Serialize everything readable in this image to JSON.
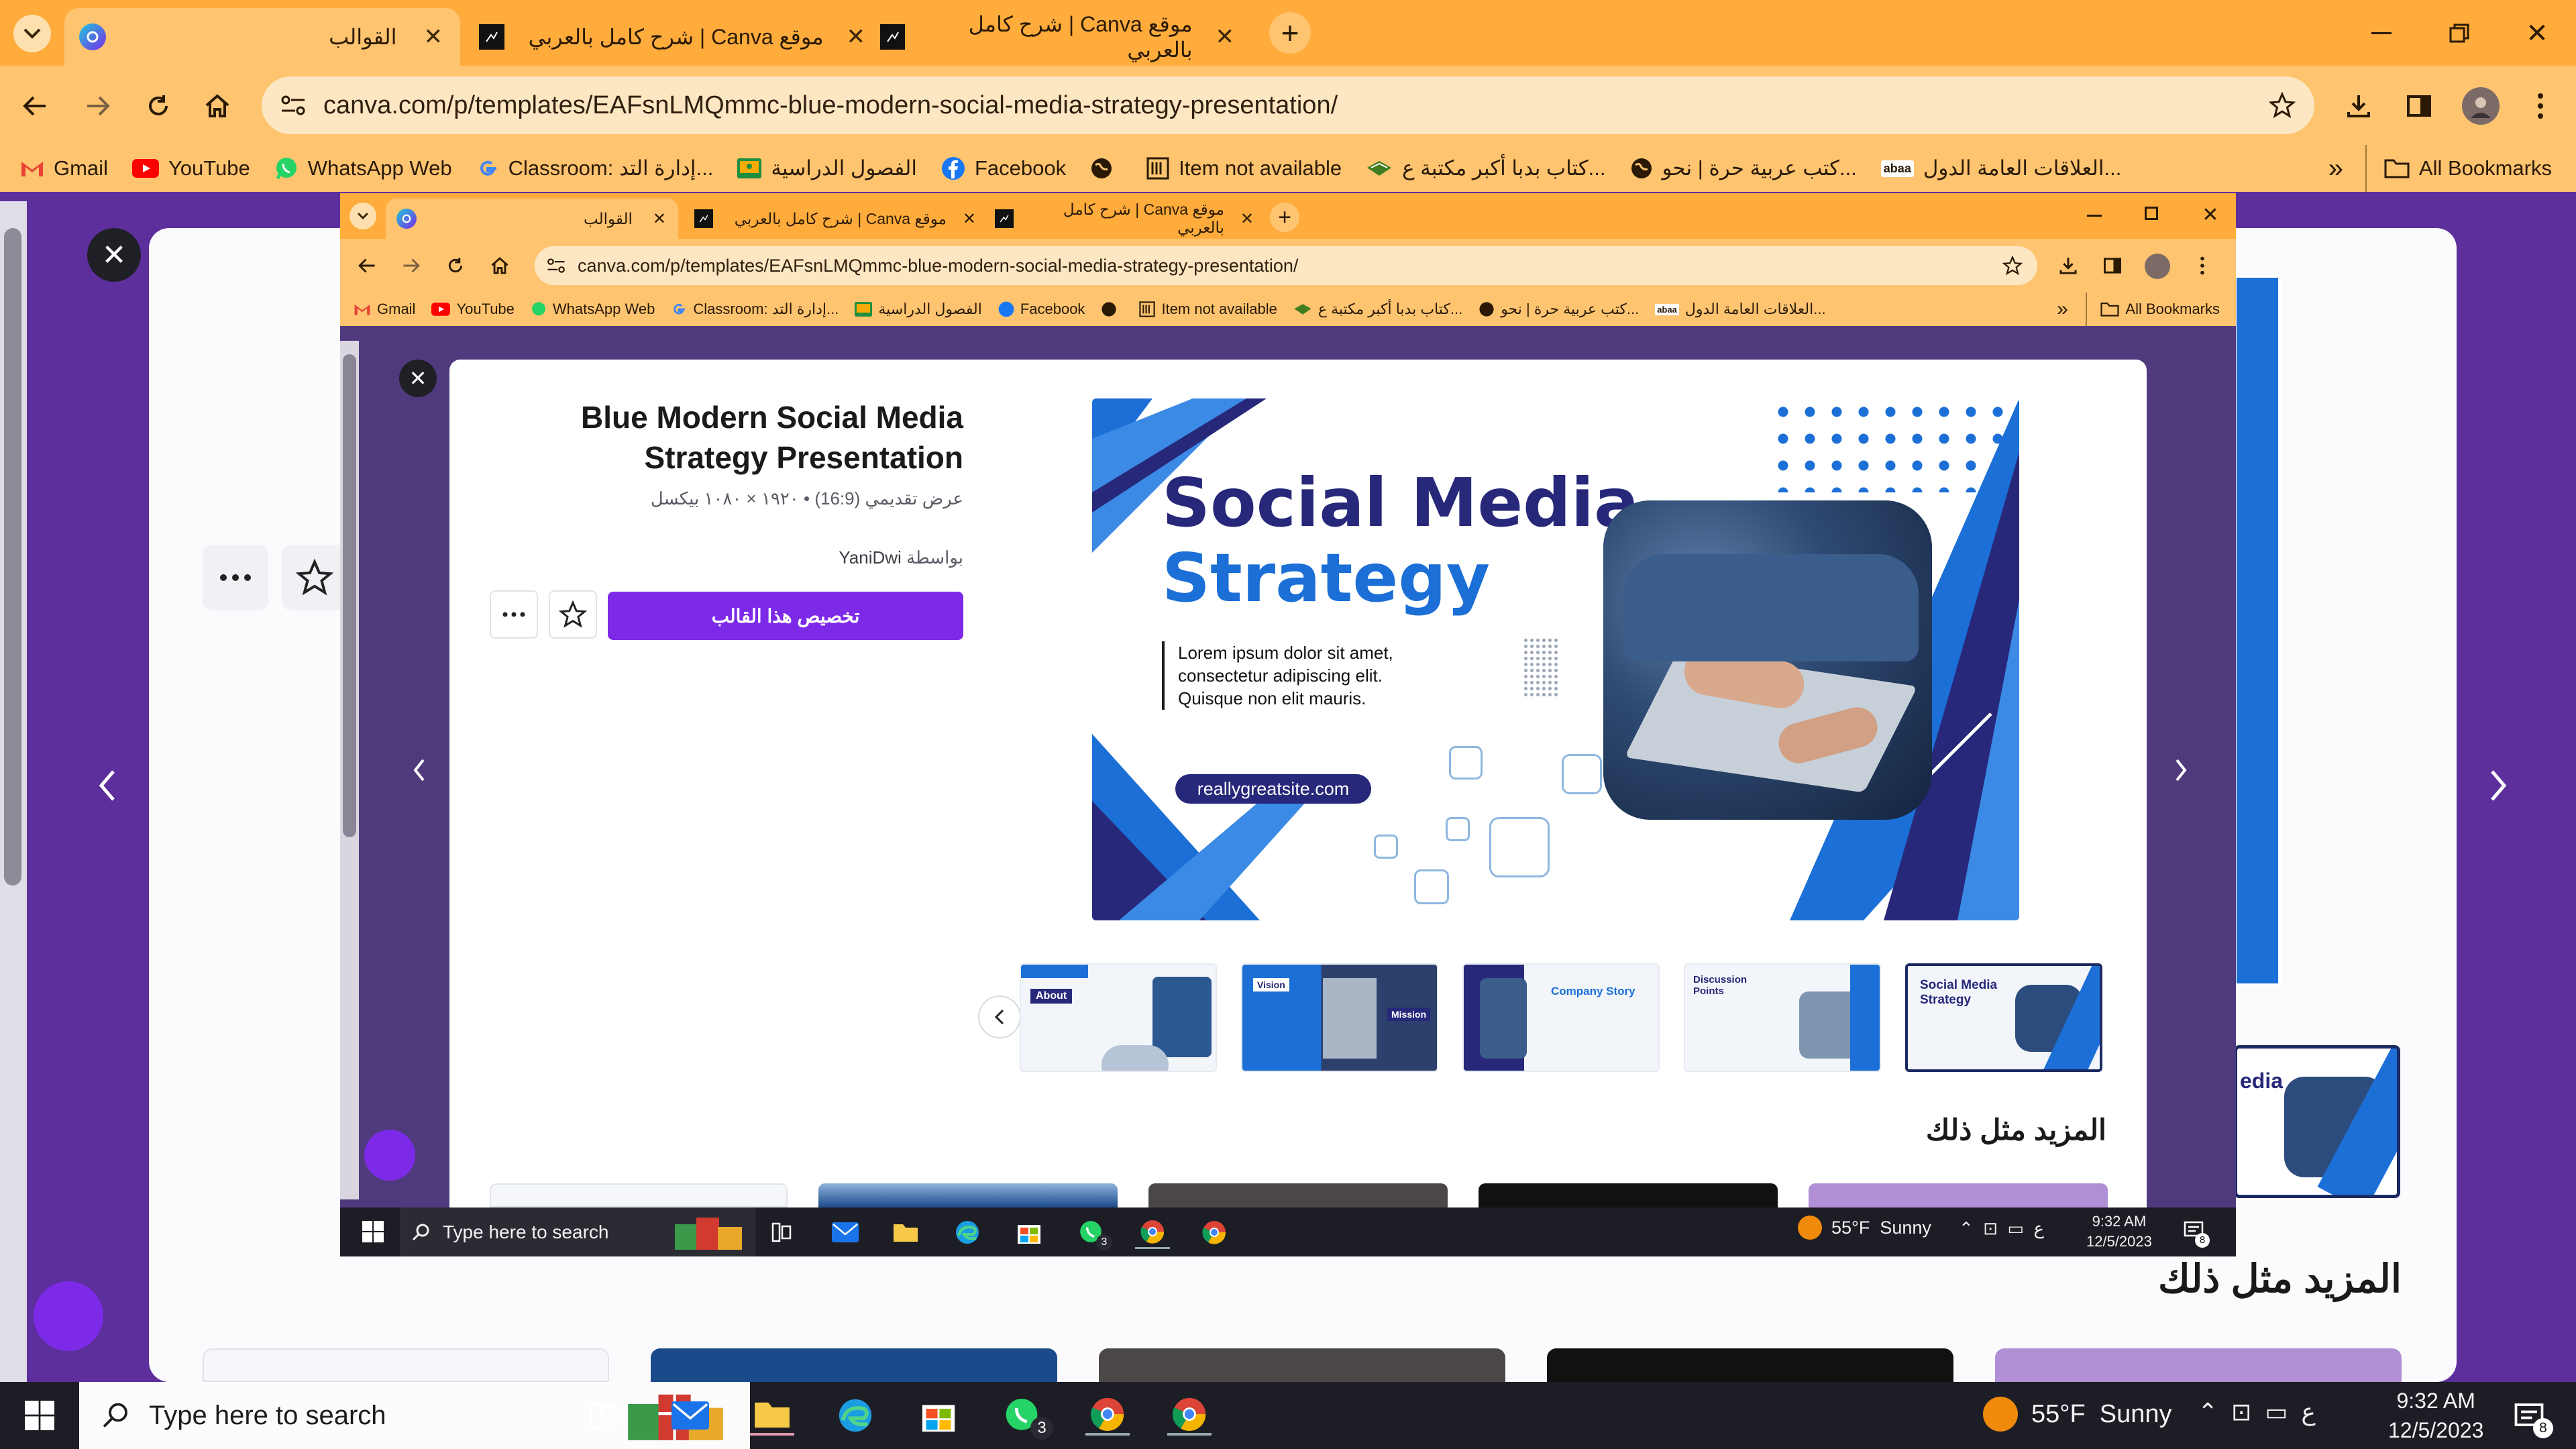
{
  "outer": {
    "tabs": [
      {
        "title": "القوالب",
        "icon": "canva-icon",
        "active": true
      },
      {
        "title": "موقع Canva | شرح كامل بالعربي",
        "icon": "site-favicon",
        "active": false
      },
      {
        "title": "موقع Canva | شرح كامل بالعربي",
        "icon": "site-favicon",
        "active": false
      }
    ],
    "url": "canva.com/p/templates/EAFsnLMQmmc-blue-modern-social-media-strategy-presentation/",
    "bookmarks": [
      {
        "label": "Gmail",
        "icon": "gmail-icon"
      },
      {
        "label": "YouTube",
        "icon": "youtube-icon"
      },
      {
        "label": "WhatsApp Web",
        "icon": "whatsapp-icon"
      },
      {
        "label": "Classroom: إدارة التد...",
        "icon": "google-icon"
      },
      {
        "label": "الفصول الدراسية",
        "icon": "classroom-icon"
      },
      {
        "label": "Facebook",
        "icon": "facebook-icon"
      },
      {
        "label": "",
        "icon": "globe-icon"
      },
      {
        "label": "Item not available",
        "icon": "book-icon"
      },
      {
        "label": "كتاب بدبا أكبر مكتبة ع...",
        "icon": "library-icon"
      },
      {
        "label": "كتب عربية حرة | نحو...",
        "icon": "globe-icon"
      },
      {
        "label": "العلاقات العامة الدول...",
        "icon": "abaa-icon"
      }
    ],
    "all_bookmarks": "All Bookmarks",
    "more_like_this": "المزيد مثل ذلك",
    "partial_slide_text": "edia"
  },
  "inner": {
    "tabs": [
      {
        "title": "القوالب",
        "active": true
      },
      {
        "title": "موقع Canva | شرح كامل بالعربي",
        "active": false
      },
      {
        "title": "موقع Canva | شرح كامل بالعربي",
        "active": false
      }
    ],
    "url": "canva.com/p/templates/EAFsnLMQmmc-blue-modern-social-media-strategy-presentation/",
    "bookmarks": [
      {
        "label": "Gmail"
      },
      {
        "label": "YouTube"
      },
      {
        "label": "WhatsApp Web"
      },
      {
        "label": "Classroom: إدارة التد..."
      },
      {
        "label": "الفصول الدراسية"
      },
      {
        "label": "Facebook"
      },
      {
        "label": ""
      },
      {
        "label": "Item not available"
      },
      {
        "label": "كتاب بدبا أكبر مكتبة ع..."
      },
      {
        "label": "كتب عربية حرة | نحو..."
      },
      {
        "label": "العلاقات العامة الدول..."
      }
    ],
    "all_bookmarks": "All Bookmarks"
  },
  "template": {
    "title_line1": "Blue Modern Social Media",
    "title_line2": "Strategy Presentation",
    "meta": "عرض تقديمي (16:9) • ١٩٢٠ × ١٠٨٠ بيكسل",
    "author_prefix": "بواسطة",
    "author": "YaniDwi",
    "customize_button": "تخصيص هذا القالب",
    "more_like_this": "المزيد مثل ذلك"
  },
  "slide": {
    "heading_line1": "Social Media",
    "heading_line2": "Strategy",
    "body": [
      "Lorem ipsum dolor sit amet,",
      "consectetur adipiscing elit.",
      "Quisque non elit mauris."
    ],
    "website": "reallygreatsite.com"
  },
  "thumbnails": [
    {
      "label": "About"
    },
    {
      "label": "Vision",
      "label2": "Mission"
    },
    {
      "label": "Company Story"
    },
    {
      "label": "Discussion Points"
    },
    {
      "label": "Social Media Strategy",
      "selected": true
    }
  ],
  "taskbar": {
    "search_placeholder": "Type here to search",
    "weather": "55°F  Sunny",
    "time": "9:32 AM",
    "date": "12/5/2023",
    "lang": "ع",
    "whatsapp_badge": "3",
    "notif_badge": "8"
  },
  "colors": {
    "chrome_orange": "#ffac3d",
    "chrome_light": "#ffc470",
    "canva_purple": "#7d2ae8",
    "slide_navy": "#27287a",
    "slide_blue": "#1b6fd6"
  }
}
